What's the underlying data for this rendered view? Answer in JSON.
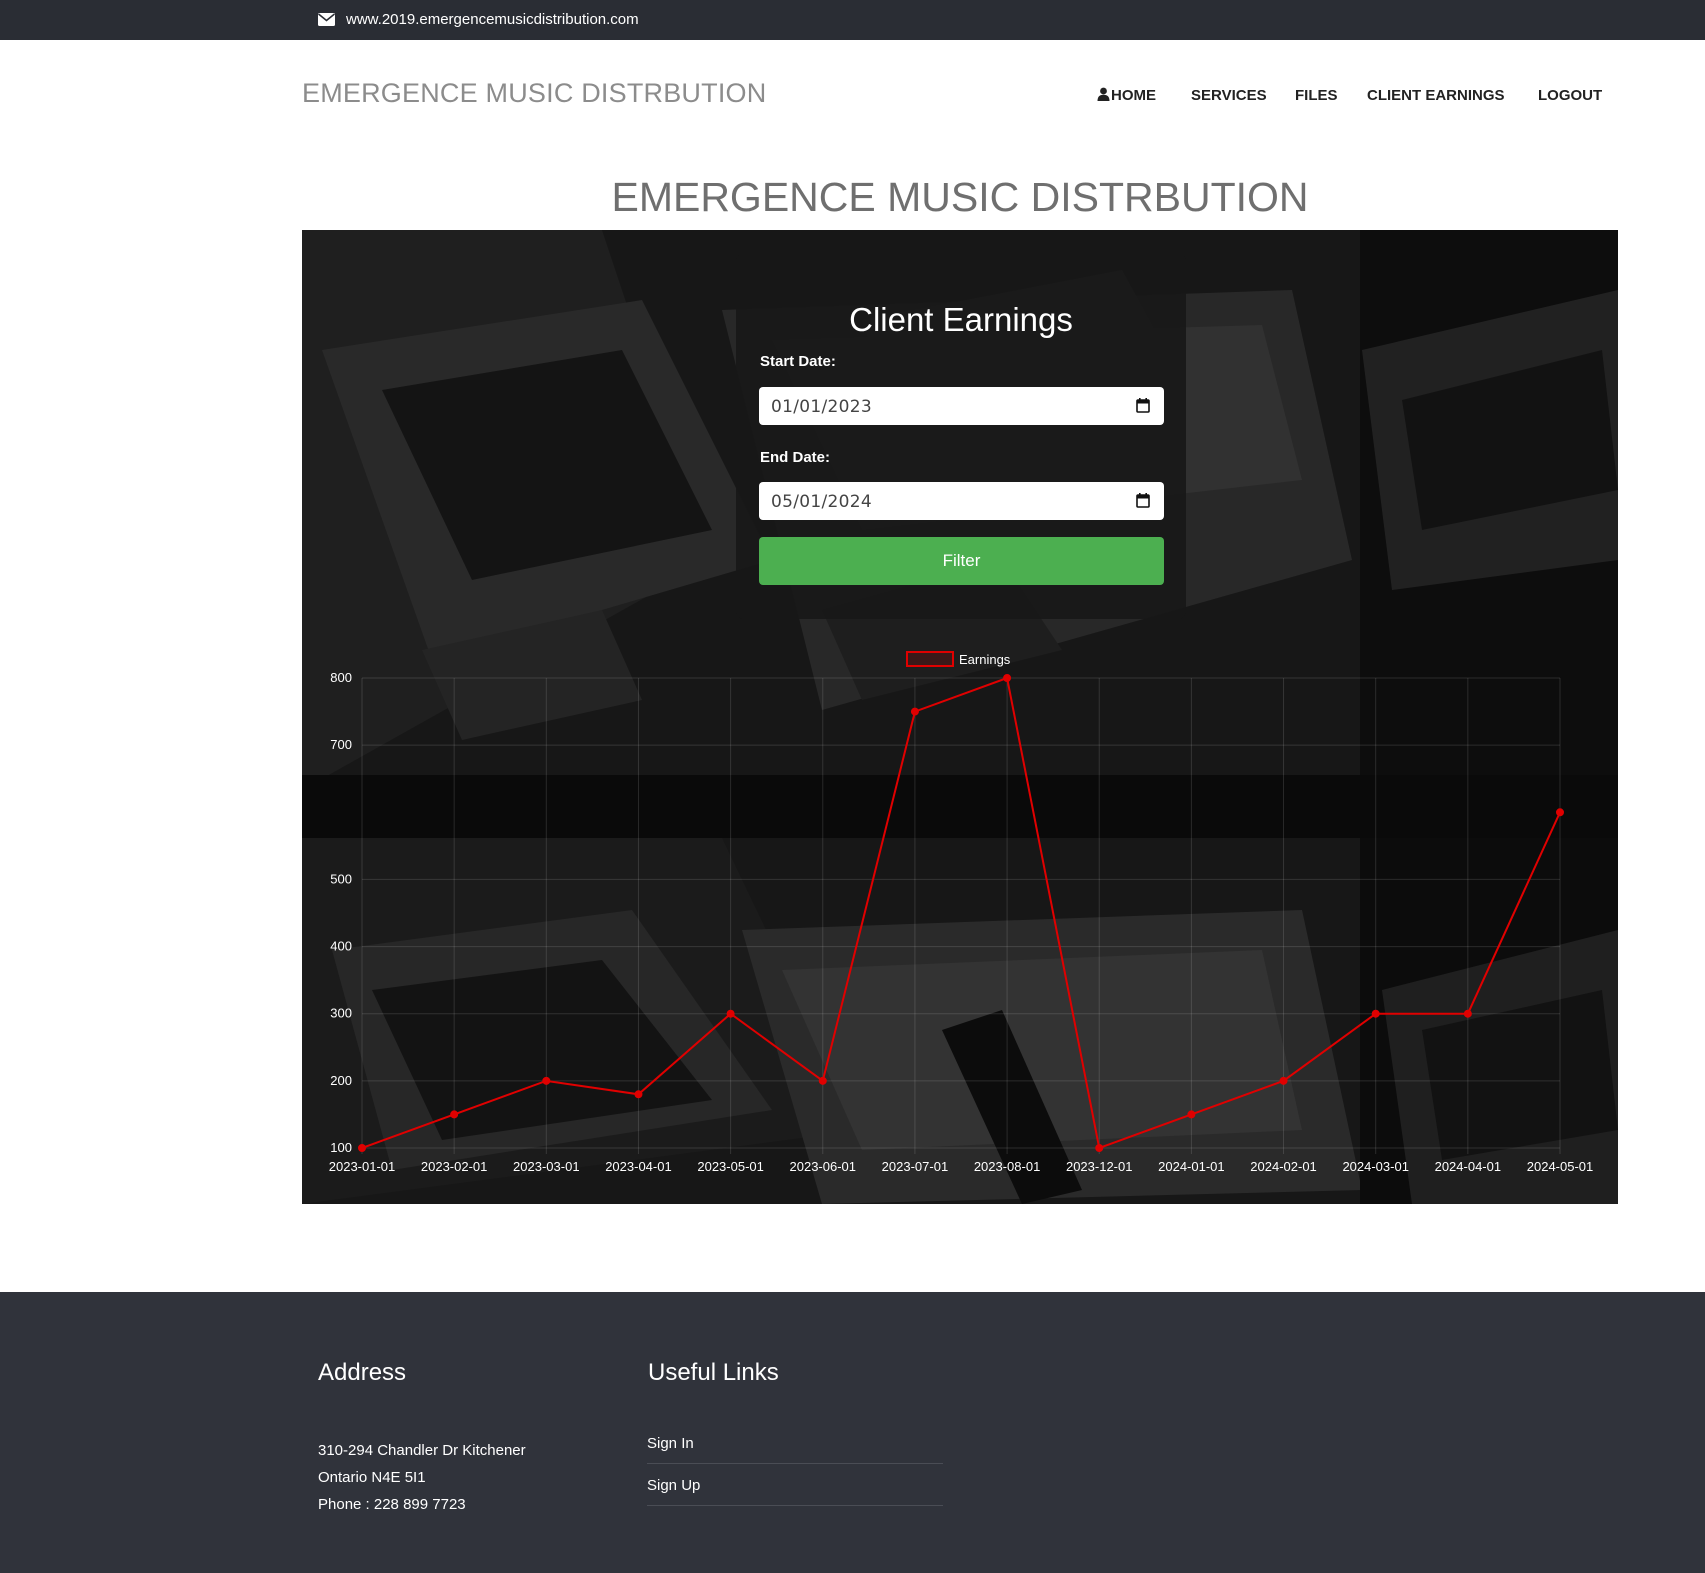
{
  "topbar": {
    "url": "www.2019.emergencemusicdistribution.com",
    "icon": "envelope-icon"
  },
  "header": {
    "brand": "EMERGENCE MUSIC DISTRBUTION",
    "nav": [
      {
        "label": "HOME",
        "icon": "user-icon"
      },
      {
        "label": "SERVICES"
      },
      {
        "label": "FILES"
      },
      {
        "label": "CLIENT EARNINGS"
      },
      {
        "label": "LOGOUT"
      }
    ]
  },
  "page": {
    "title": "EMERGENCE MUSIC DISTRBUTION"
  },
  "filter_card": {
    "title": "Client Earnings",
    "start_label": "Start Date:",
    "start_value": "01/01/2023",
    "end_label": "End Date:",
    "end_value": "05/01/2024",
    "button_label": "Filter",
    "button_color": "#4caf50"
  },
  "chart_data": {
    "type": "line",
    "x": [
      "2023-01-01",
      "2023-02-01",
      "2023-03-01",
      "2023-04-01",
      "2023-05-01",
      "2023-06-01",
      "2023-07-01",
      "2023-08-01",
      "2023-12-01",
      "2024-01-01",
      "2024-02-01",
      "2024-03-01",
      "2024-04-01",
      "2024-05-01"
    ],
    "series": [
      {
        "name": "Earnings",
        "color": "#e00000",
        "values": [
          100,
          150,
          200,
          180,
          300,
          200,
          750,
          800,
          100,
          150,
          200,
          300,
          300,
          600
        ]
      }
    ],
    "yticks": [
      100,
      200,
      300,
      400,
      500,
      700,
      800
    ],
    "ylim": [
      100,
      800
    ],
    "grid": true,
    "legend": "top"
  },
  "footer": {
    "address_heading": "Address",
    "address_lines": [
      "310-294 Chandler Dr Kitchener",
      "Ontario N4E 5I1",
      "Phone : 228 899 7723"
    ],
    "links_heading": "Useful Links",
    "links": [
      "Sign In",
      "Sign Up"
    ]
  }
}
